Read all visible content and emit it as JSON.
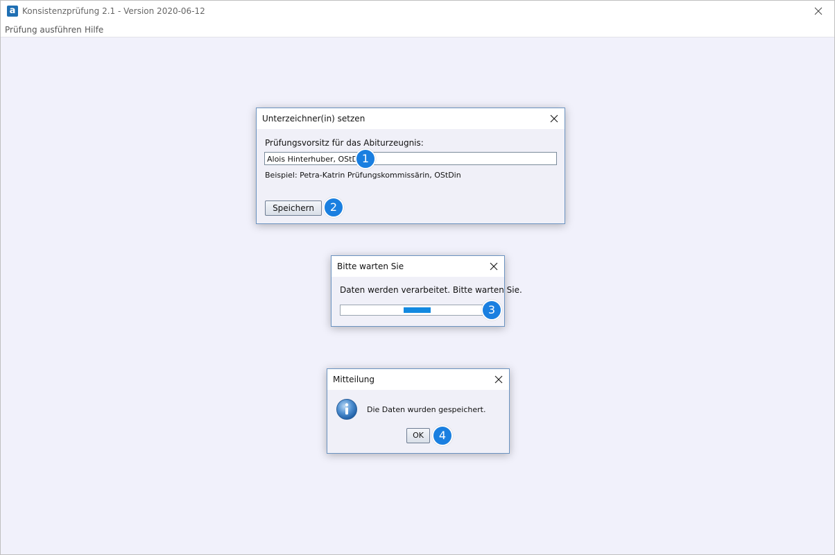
{
  "app": {
    "logo_letter": "a",
    "title": "Konsistenzprüfung 2.1 - Version 2020-06-12"
  },
  "menu": {
    "items": [
      {
        "label": "Prüfung ausführen"
      },
      {
        "label": "Hilfe"
      }
    ]
  },
  "dialog_signer": {
    "title": "Unterzeichner(in) setzen",
    "field_label": "Prüfungsvorsitz für das Abiturzeugnis:",
    "input_value": "Alois Hinterhuber, OStD",
    "example": "Beispiel: Petra-Katrin Prüfungskommissärin, OStDin",
    "save_label": "Speichern",
    "badge_input": "1",
    "badge_save": "2"
  },
  "dialog_wait": {
    "title": "Bitte warten Sie",
    "message": "Daten werden verarbeitet. Bitte warten Sie.",
    "badge": "3",
    "progress_segment": {
      "start_fraction": 0.44,
      "end_fraction": 0.63
    }
  },
  "dialog_message": {
    "title": "Mitteilung",
    "icon": "info-icon",
    "message": "Die Daten wurden gespeichert.",
    "ok_label": "OK",
    "badge": "4"
  },
  "colors": {
    "badge": "#1a7fe0",
    "progress": "#1289e0",
    "dialog_border": "#6a92c0"
  }
}
